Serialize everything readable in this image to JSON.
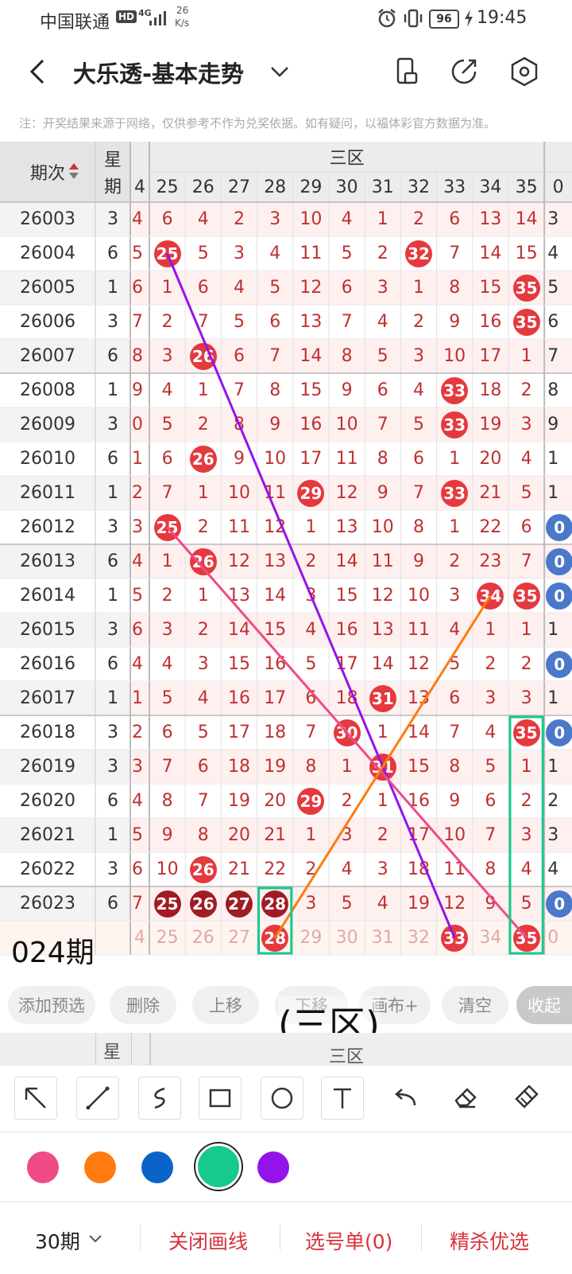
{
  "status": {
    "carrier": "中国联通",
    "hd": "HD",
    "net": "4G",
    "speed_value": "26",
    "speed_unit": "K/s",
    "battery": "96",
    "time": "19:45"
  },
  "header": {
    "title": "大乐透-基本走势"
  },
  "note": "注：开奖结果来源于网络，仅供参考不作为兑奖依据。如有疑问，以福体彩官方数据为准。",
  "table": {
    "col_issue": "期次",
    "col_week_a": "星",
    "col_week_b": "期",
    "zone_title": "三区",
    "partial_col": "4",
    "numbers": [
      "25",
      "26",
      "27",
      "28",
      "29",
      "30",
      "31",
      "32",
      "33",
      "34",
      "35"
    ],
    "right_partial": "0",
    "rows": [
      {
        "issue": "26003",
        "week": "3",
        "edge": "4",
        "cells": [
          "6",
          "4",
          "2",
          "3",
          "10",
          "4",
          "1",
          "2",
          "6",
          "13",
          "14"
        ],
        "right": "3"
      },
      {
        "issue": "26004",
        "week": "6",
        "edge": "5",
        "cells": [
          "25",
          "5",
          "3",
          "4",
          "11",
          "5",
          "2",
          "32",
          "7",
          "14",
          "15"
        ],
        "right": "4"
      },
      {
        "issue": "26005",
        "week": "1",
        "edge": "6",
        "cells": [
          "1",
          "6",
          "4",
          "5",
          "12",
          "6",
          "3",
          "1",
          "8",
          "15",
          "35"
        ],
        "right": "5"
      },
      {
        "issue": "26006",
        "week": "3",
        "edge": "7",
        "cells": [
          "2",
          "7",
          "5",
          "6",
          "13",
          "7",
          "4",
          "2",
          "9",
          "16",
          "35"
        ],
        "right": "6"
      },
      {
        "issue": "26007",
        "week": "6",
        "edge": "8",
        "cells": [
          "3",
          "26",
          "6",
          "7",
          "14",
          "8",
          "5",
          "3",
          "10",
          "17",
          "1"
        ],
        "right": "7"
      },
      {
        "issue": "26008",
        "week": "1",
        "edge": "9",
        "cells": [
          "4",
          "1",
          "7",
          "8",
          "15",
          "9",
          "6",
          "4",
          "33",
          "18",
          "2"
        ],
        "right": "8"
      },
      {
        "issue": "26009",
        "week": "3",
        "edge": "0",
        "cells": [
          "5",
          "2",
          "8",
          "9",
          "16",
          "10",
          "7",
          "5",
          "33",
          "19",
          "3"
        ],
        "right": "9"
      },
      {
        "issue": "26010",
        "week": "6",
        "edge": "1",
        "cells": [
          "6",
          "26",
          "9",
          "10",
          "17",
          "11",
          "8",
          "6",
          "1",
          "20",
          "4"
        ],
        "right": "1"
      },
      {
        "issue": "26011",
        "week": "1",
        "edge": "2",
        "cells": [
          "7",
          "1",
          "10",
          "11",
          "29",
          "12",
          "9",
          "7",
          "33",
          "21",
          "5"
        ],
        "right": "1"
      },
      {
        "issue": "26012",
        "week": "3",
        "edge": "3",
        "cells": [
          "25",
          "2",
          "11",
          "12",
          "1",
          "13",
          "10",
          "8",
          "1",
          "22",
          "6"
        ],
        "right": "0"
      },
      {
        "issue": "26013",
        "week": "6",
        "edge": "4",
        "cells": [
          "1",
          "26",
          "12",
          "13",
          "2",
          "14",
          "11",
          "9",
          "2",
          "23",
          "7"
        ],
        "right": "0"
      },
      {
        "issue": "26014",
        "week": "1",
        "edge": "5",
        "cells": [
          "2",
          "1",
          "13",
          "14",
          "3",
          "15",
          "12",
          "10",
          "3",
          "34",
          "35"
        ],
        "right": "0"
      },
      {
        "issue": "26015",
        "week": "3",
        "edge": "6",
        "cells": [
          "3",
          "2",
          "14",
          "15",
          "4",
          "16",
          "13",
          "11",
          "4",
          "1",
          "1"
        ],
        "right": "1"
      },
      {
        "issue": "26016",
        "week": "6",
        "edge": "4",
        "cells": [
          "4",
          "3",
          "15",
          "16",
          "5",
          "17",
          "14",
          "12",
          "5",
          "2",
          "2"
        ],
        "right": "0"
      },
      {
        "issue": "26017",
        "week": "1",
        "edge": "1",
        "cells": [
          "5",
          "4",
          "16",
          "17",
          "6",
          "18",
          "31",
          "13",
          "6",
          "3",
          "3"
        ],
        "right": "1"
      },
      {
        "issue": "26018",
        "week": "3",
        "edge": "2",
        "cells": [
          "6",
          "5",
          "17",
          "18",
          "7",
          "30",
          "1",
          "14",
          "7",
          "4",
          "35"
        ],
        "right": "0"
      },
      {
        "issue": "26019",
        "week": "3",
        "edge": "3",
        "cells": [
          "7",
          "6",
          "18",
          "19",
          "8",
          "1",
          "31",
          "15",
          "8",
          "5",
          "1"
        ],
        "right": "1"
      },
      {
        "issue": "26020",
        "week": "6",
        "edge": "4",
        "cells": [
          "8",
          "7",
          "19",
          "20",
          "29",
          "2",
          "1",
          "16",
          "9",
          "6",
          "2"
        ],
        "right": "2"
      },
      {
        "issue": "26021",
        "week": "1",
        "edge": "5",
        "cells": [
          "9",
          "8",
          "20",
          "21",
          "1",
          "3",
          "2",
          "17",
          "10",
          "7",
          "3"
        ],
        "right": "3"
      },
      {
        "issue": "26022",
        "week": "3",
        "edge": "6",
        "cells": [
          "10",
          "26",
          "21",
          "22",
          "2",
          "4",
          "3",
          "18",
          "11",
          "8",
          "4"
        ],
        "right": "4"
      },
      {
        "issue": "26023",
        "week": "6",
        "edge": "7",
        "cells": [
          "25",
          "26",
          "27",
          "28",
          "3",
          "5",
          "4",
          "19",
          "12",
          "9",
          "5"
        ],
        "right": "0"
      }
    ],
    "predict": {
      "label": "024期",
      "edge": "4",
      "cells": [
        "25",
        "26",
        "27",
        "28",
        "29",
        "30",
        "31",
        "32",
        "33",
        "34",
        "35"
      ],
      "right": "0"
    }
  },
  "annotation": "(三区)",
  "buttons": {
    "add": "添加预选",
    "del": "删除",
    "up": "上移",
    "down": "下移",
    "canvas": "画布+",
    "clear": "清空",
    "collapse": "收起"
  },
  "ghost": {
    "week": "星",
    "zone": "三区"
  },
  "colors": [
    "#ef4b86",
    "#ff7a0f",
    "#0a63c9",
    "#16c98d",
    "#9413ea"
  ],
  "bottom": {
    "periods": "30期",
    "close_draw": "关闭画线",
    "pick_list": "选号单(0)",
    "smart": "精杀优选"
  }
}
